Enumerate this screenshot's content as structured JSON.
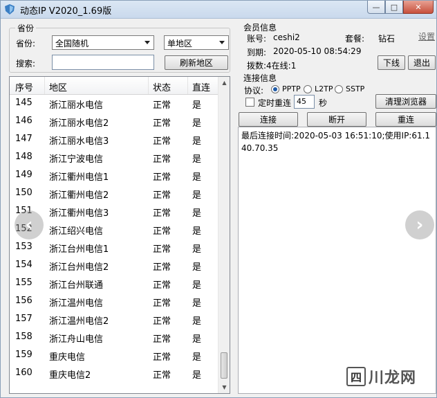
{
  "window": {
    "title": "动态IP V2020_1.69版",
    "buttons": {
      "minimize": "—",
      "maximize": "□",
      "close": "✕"
    }
  },
  "province_group": {
    "title": "省份",
    "province_label": "省份:",
    "province_value": "全国随机",
    "mode_value": "单地区",
    "search_label": "搜索:",
    "search_value": "",
    "refresh_button": "刷新地区"
  },
  "list": {
    "headers": [
      "序号",
      "地区",
      "状态",
      "直连"
    ],
    "rows": [
      {
        "id": "145",
        "region": "浙江丽水电信",
        "status": "正常",
        "direct": "是"
      },
      {
        "id": "146",
        "region": "浙江丽水电信2",
        "status": "正常",
        "direct": "是"
      },
      {
        "id": "147",
        "region": "浙江丽水电信3",
        "status": "正常",
        "direct": "是"
      },
      {
        "id": "148",
        "region": "浙江宁波电信",
        "status": "正常",
        "direct": "是"
      },
      {
        "id": "149",
        "region": "浙江衢州电信1",
        "status": "正常",
        "direct": "是"
      },
      {
        "id": "150",
        "region": "浙江衢州电信2",
        "status": "正常",
        "direct": "是"
      },
      {
        "id": "151",
        "region": "浙江衢州电信3",
        "status": "正常",
        "direct": "是"
      },
      {
        "id": "152",
        "region": "浙江绍兴电信",
        "status": "正常",
        "direct": "是"
      },
      {
        "id": "153",
        "region": "浙江台州电信1",
        "status": "正常",
        "direct": "是"
      },
      {
        "id": "154",
        "region": "浙江台州电信2",
        "status": "正常",
        "direct": "是"
      },
      {
        "id": "155",
        "region": "浙江台州联通",
        "status": "正常",
        "direct": "是"
      },
      {
        "id": "156",
        "region": "浙江温州电信",
        "status": "正常",
        "direct": "是"
      },
      {
        "id": "157",
        "region": "浙江温州电信2",
        "status": "正常",
        "direct": "是"
      },
      {
        "id": "158",
        "region": "浙江舟山电信",
        "status": "正常",
        "direct": "是"
      },
      {
        "id": "159",
        "region": "重庆电信",
        "status": "正常",
        "direct": "是"
      },
      {
        "id": "160",
        "region": "重庆电信2",
        "status": "正常",
        "direct": "是"
      }
    ]
  },
  "member": {
    "title": "会员信息",
    "account_label": "账号:",
    "account_value": "ceshi2",
    "plan_label": "套餐:",
    "plan_value": "钻石",
    "settings_link": "设置",
    "expiry_label": "到期:",
    "expiry_value": "2020-05-10 08:54:29",
    "dial_text": "拨数:4在线:1",
    "logout_button": "下线",
    "exit_button": "退出"
  },
  "connection": {
    "title": "连接信息",
    "protocol_label": "协议:",
    "protocols": [
      "PPTP",
      "L2TP",
      "SSTP"
    ],
    "selected_protocol": "PPTP",
    "timer_label": "定时重连",
    "timer_value": "45",
    "timer_unit": "秒",
    "clear_browser_button": "清理浏览器",
    "connect_button": "连接",
    "disconnect_button": "断开",
    "reconnect_button": "重连"
  },
  "log": {
    "text": "最后连接时间:2020-05-03 16:51:10;使用IP:61.140.70.35"
  },
  "overlay": {
    "prev_icon": "‹",
    "next_icon": "›",
    "watermark_box": "四",
    "watermark_text": "川龙网"
  }
}
